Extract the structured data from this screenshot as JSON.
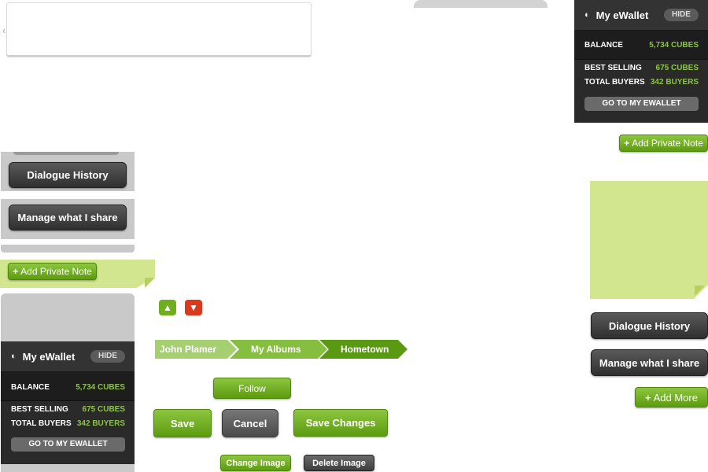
{
  "top": {
    "back_icon": "chevron-left-icon"
  },
  "left_sidebar": {
    "dialogue_history": "Dialogue History",
    "manage_share": "Manage what I share",
    "add_private_note": "Add Private Note"
  },
  "wallet_top": {
    "title": "My eWallet",
    "hide": "HIDE",
    "balance_label": "BALANCE",
    "balance_value": "5,734 CUBES",
    "best_selling_label": "BEST SELLING",
    "best_selling_value": "675 CUBES",
    "total_buyers_label": "TOTAL BUYERS",
    "total_buyers_value": "342 BUYERS",
    "goto": "GO TO MY EWALLET"
  },
  "wallet_left": {
    "title": "My eWallet",
    "hide": "HIDE",
    "balance_label": "BALANCE",
    "balance_value": "5,734 CUBES",
    "best_selling_label": "BEST SELLING",
    "best_selling_value": "675 CUBES",
    "total_buyers_label": "TOTAL BUYERS",
    "total_buyers_value": "342 BUYERS",
    "goto": "GO TO MY EWALLET"
  },
  "right_panel": {
    "add_private_note": "Add Private Note",
    "dialogue_history": "Dialogue History",
    "manage_share": "Manage what I share",
    "add_more": "Add More"
  },
  "icons": {
    "like": "thumbs-up-icon",
    "dislike": "thumbs-down-icon"
  },
  "breadcrumb": [
    "John Plamer",
    "My Albums",
    "Hometown"
  ],
  "buttons": {
    "follow": "Follow",
    "save": "Save",
    "cancel": "Cancel",
    "save_changes": "Save Changes",
    "change_image": "Change Image",
    "delete_image": "Delete Image"
  },
  "colors": {
    "green": "#6fae1f",
    "dark": "#2a2a2a",
    "note": "#d2e58f",
    "red": "#d9391c"
  }
}
